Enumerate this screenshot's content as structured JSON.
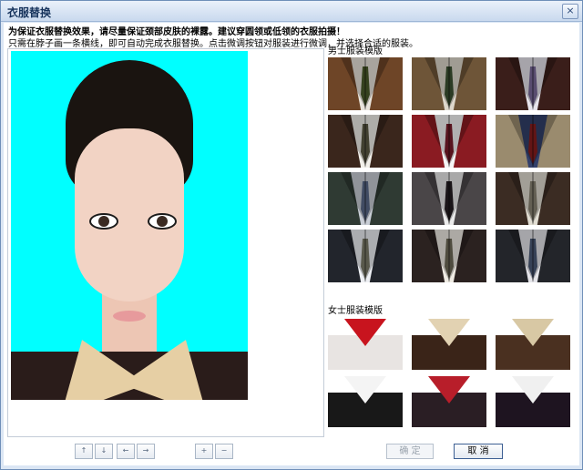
{
  "window": {
    "title": "衣服替换",
    "close_glyph": "×"
  },
  "notice": "为保证衣服替换效果，请尽量保证颈部皮肤的裸露。建议穿圆领或低领的衣服拍摄！",
  "hint": "只需在脖子画一条横线，即可自动完成衣服替换。点击微调按钮对服装进行微调，并选择合适的服装。",
  "sections": {
    "men": "男士服装模版",
    "women": "女士服装模版"
  },
  "men_templates": [
    {
      "bg": "#6e4527",
      "shirt": "#e9e4dc",
      "tie": "#4a5a2a"
    },
    {
      "bg": "#6e5538",
      "shirt": "#ded8cc",
      "tie": "#3c5232"
    },
    {
      "bg": "#3a1e1a",
      "shirt": "#e7e4ec",
      "tie": "#7a6a9a"
    },
    {
      "bg": "#3a261c",
      "shirt": "#f2f0ea",
      "tie": "#5c5a44"
    },
    {
      "bg": "#8a1b22",
      "shirt": "#f6f6f6",
      "tie": "#7a1d2a"
    },
    {
      "bg": "#9a8b6e",
      "shirt": "#33406a",
      "tie": "#8a1e1e"
    },
    {
      "bg": "#2f3a33",
      "shirt": "#c9ced6",
      "tie": "#5b6a8a"
    },
    {
      "bg": "#4a4648",
      "shirt": "#ebebeb",
      "tie": "#241e22"
    },
    {
      "bg": "#3b2c23",
      "shirt": "#e1ddd2",
      "tie": "#8a8474"
    },
    {
      "bg": "#22252c",
      "shirt": "#eef0f4",
      "tie": "#7c7c6a"
    },
    {
      "bg": "#2b2220",
      "shirt": "#efebe3",
      "tie": "#6e6a58"
    },
    {
      "bg": "#23252a",
      "shirt": "#e5e5ea",
      "tie": "#4c5a78"
    }
  ],
  "women_templates": [
    {
      "bg": "#ffffff",
      "body": "#e8e4e2",
      "collar": "#c8141e"
    },
    {
      "bg": "#ffffff",
      "body": "#3a2418",
      "collar": "#e2d2b2"
    },
    {
      "bg": "#ffffff",
      "body": "#4a3020",
      "collar": "#d8c8a4"
    },
    {
      "bg": "#ffffff",
      "body": "#181818",
      "collar": "#f4f4f4"
    },
    {
      "bg": "#ffffff",
      "body": "#2a1e24",
      "collar": "#b81e2a"
    },
    {
      "bg": "#ffffff",
      "body": "#1e1420",
      "collar": "#f0f0f0"
    }
  ],
  "arrows": [
    "↑",
    "↓",
    "←",
    "→"
  ],
  "zoom": [
    "+",
    "−"
  ],
  "buttons": {
    "ok": "确 定",
    "cancel": "取 消"
  }
}
